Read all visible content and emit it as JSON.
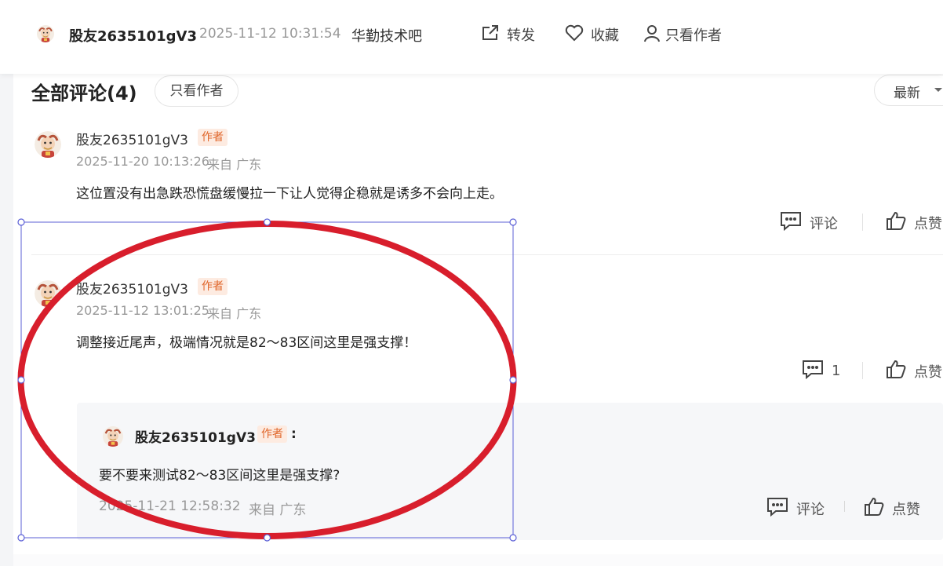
{
  "header": {
    "username": "股友2635101gV3",
    "timestamp": "2025-11-12 10:31:54",
    "forum": "华勤技术吧",
    "share_label": "转发",
    "favorite_label": "收藏",
    "author_only_label": "只看作者"
  },
  "comments_section": {
    "title": "全部评论(4)",
    "author_only_label": "只看作者",
    "sort_label": "最新"
  },
  "comments": [
    {
      "username": "股友2635101gV3",
      "badge": "作者",
      "time": "2025-11-20 10:13:26",
      "location": "来自 广东",
      "text": "这位置没有出急跌恐慌盘缓慢拉一下让人觉得企稳就是诱多不会向上走。",
      "comment_label": "评论",
      "like_label": "点赞"
    },
    {
      "username": "股友2635101gV3",
      "badge": "作者",
      "time": "2025-11-12 13:01:25",
      "location": "来自 广东",
      "text": "调整接近尾声，极端情况就是82～83区间这里是强支撑！",
      "comment_count": "1",
      "like_label": "点赞"
    }
  ],
  "reply": {
    "username": "股友2635101gV3",
    "badge": "作者",
    "colon": ":",
    "text": "要不要来测试82～83区间这里是强支撑?",
    "time": "2025-11-21 12:58:32",
    "location": "来自 广东",
    "comment_label": "评论",
    "like_label": "点赞"
  },
  "colors": {
    "accent_orange": "#e0662a",
    "annotation_red": "#d81e2c",
    "selection_blue": "#5b5fd6"
  },
  "icons": [
    "avatar-icon",
    "share-icon",
    "heart-icon",
    "person-icon",
    "caret-down-icon",
    "comment-icon",
    "thumbs-up-icon"
  ]
}
